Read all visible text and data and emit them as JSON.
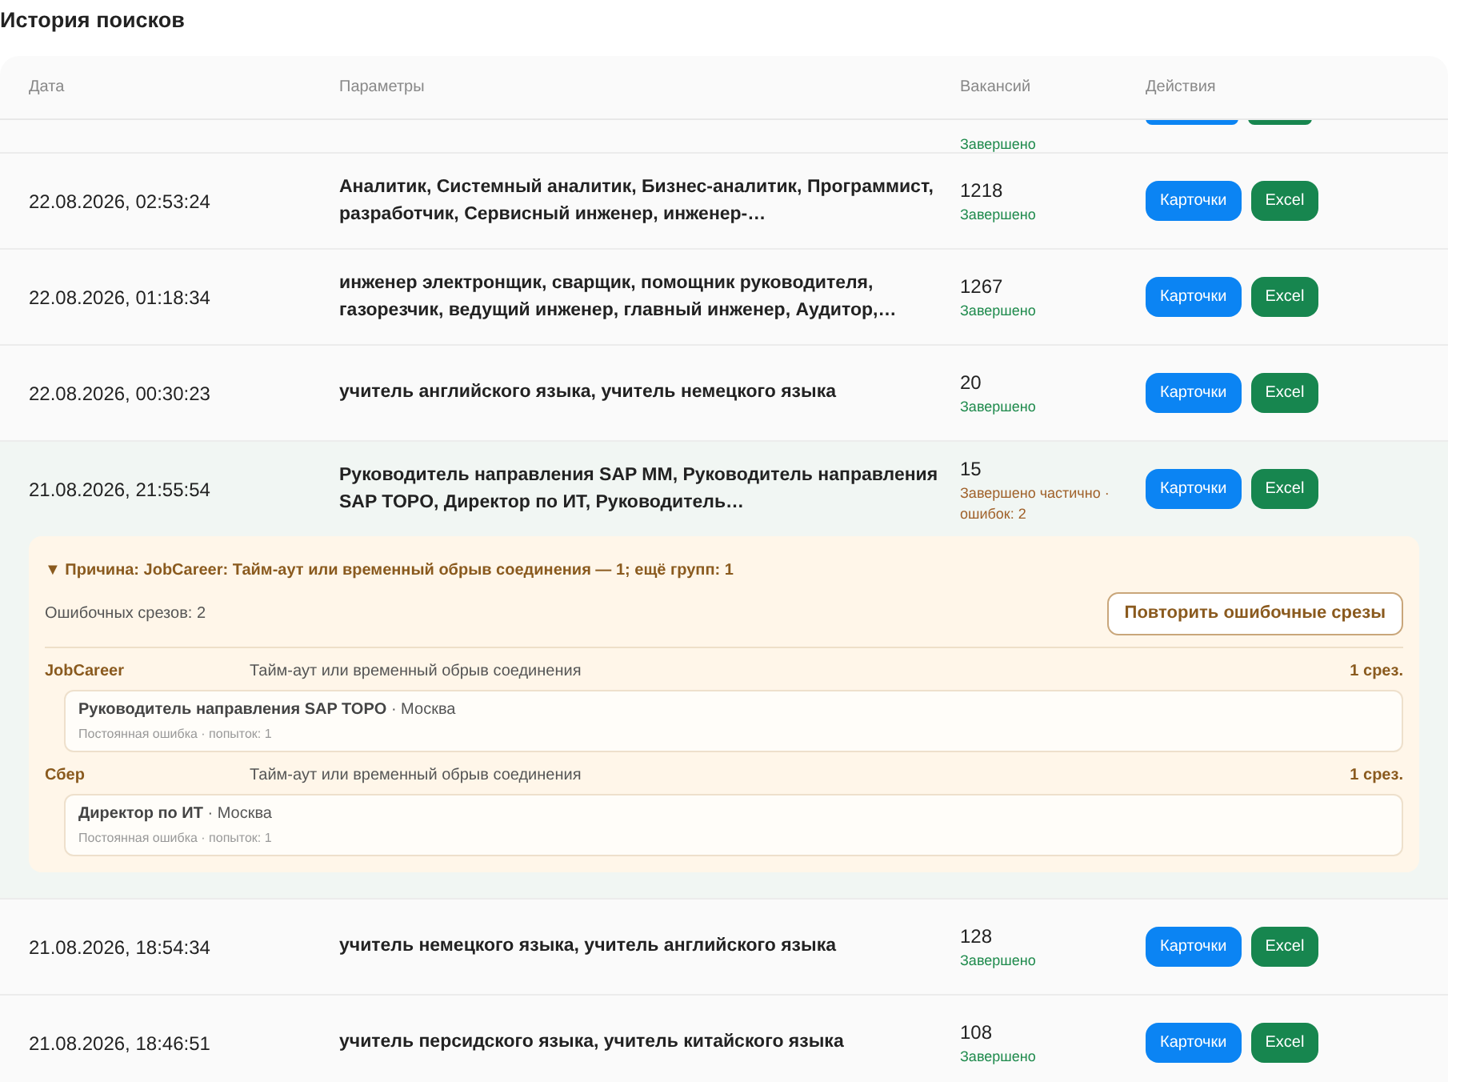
{
  "title": "История поисков",
  "columns": [
    "Дата",
    "Параметры",
    "Вакансий",
    "Действия"
  ],
  "partial_row": {
    "status": "Завершено",
    "kind": "done"
  },
  "rows": [
    {
      "date": "22.08.2026, 02:53:24",
      "params": "Аналитик, Системный аналитик, Бизнес-аналитик, Программист, разработчик, Сервисный инженер, инженер-…",
      "count": "1218",
      "status": "Завершено",
      "kind": "done",
      "actions": [
        "Карточки",
        "Excel"
      ]
    },
    {
      "date": "22.08.2026, 01:18:34",
      "params": "инженер электронщик, сварщик, помощник руководителя, газорезчик, ведущий инженер, главный инженер, Аудитор,…",
      "count": "1267",
      "status": "Завершено",
      "kind": "done",
      "actions": [
        "Карточки",
        "Excel"
      ]
    },
    {
      "date": "22.08.2026, 00:30:23",
      "params": "учитель английского языка, учитель немецкого языка",
      "count": "20",
      "status": "Завершено",
      "kind": "done",
      "actions": [
        "Карточки",
        "Excel"
      ]
    },
    {
      "date": "21.08.2026, 21:55:54",
      "params": "Руководитель направления SAP MM, Руководитель направления SAP TOPO, Директор по ИТ, Руководитель…",
      "count": "15",
      "status": "Завершено частично · ошибок: 2",
      "kind": "partial",
      "actions": [
        "Карточки",
        "Excel"
      ],
      "details": {
        "summary": "▼ Причина: JobCareer: Тайм-аут или временный обрыв соединения — 1; ещё групп: 1",
        "error_count": "Ошибочных срезов: 2",
        "retry_button": "Повторить ошибочные срезы",
        "groups": [
          {
            "source": "JobCareer",
            "reason": "Тайм-аут или временный обрыв соединения",
            "count": "1 срез.",
            "items": [
              {
                "title": "Руководитель направления SAP TOPO",
                "location": " · Москва",
                "meta": "Постоянная ошибка · попыток: 1"
              }
            ]
          },
          {
            "source": "Сбер",
            "reason": "Тайм-аут или временный обрыв соединения",
            "count": "1 срез.",
            "items": [
              {
                "title": "Директор по ИТ",
                "location": " · Москва",
                "meta": "Постоянная ошибка · попыток: 1"
              }
            ]
          }
        ]
      }
    },
    {
      "date": "21.08.2026, 18:54:34",
      "params": "учитель немецкого языка, учитель английского языка",
      "count": "128",
      "status": "Завершено",
      "kind": "done",
      "actions": [
        "Карточки",
        "Excel"
      ]
    },
    {
      "date": "21.08.2026, 18:46:51",
      "params": "учитель персидского языка, учитель китайского языка",
      "count": "108",
      "status": "Завершено",
      "kind": "done",
      "actions": [
        "Карточки",
        "Excel"
      ]
    }
  ]
}
